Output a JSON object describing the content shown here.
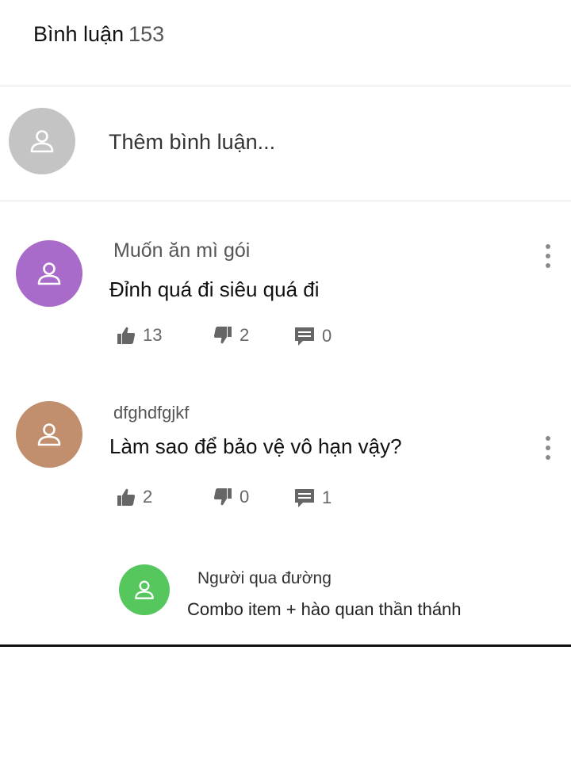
{
  "header": {
    "title": "Bình luận",
    "count": "153"
  },
  "add_comment": {
    "placeholder": "Thêm bình luận..."
  },
  "comments": [
    {
      "author": "Muốn ăn mì gói",
      "text": "Đỉnh quá đi siêu quá đi",
      "likes": "13",
      "dislikes": "2",
      "replies": "0",
      "avatar_color": "#a96bc9"
    },
    {
      "author": "dfghdfgjkf",
      "text": "Làm sao để bảo vệ vô hạn vậy?",
      "likes": "2",
      "dislikes": "0",
      "replies": "1",
      "avatar_color": "#c28f6e"
    }
  ],
  "reply": {
    "author": "Người qua đường",
    "text": "Combo item + hào quan thần thánh",
    "avatar_color": "#55c75c"
  },
  "icons": {
    "avatar": "user-icon",
    "like": "thumbs-up-icon",
    "dislike": "thumbs-down-icon",
    "reply": "comment-icon",
    "more": "more-vertical-icon"
  }
}
